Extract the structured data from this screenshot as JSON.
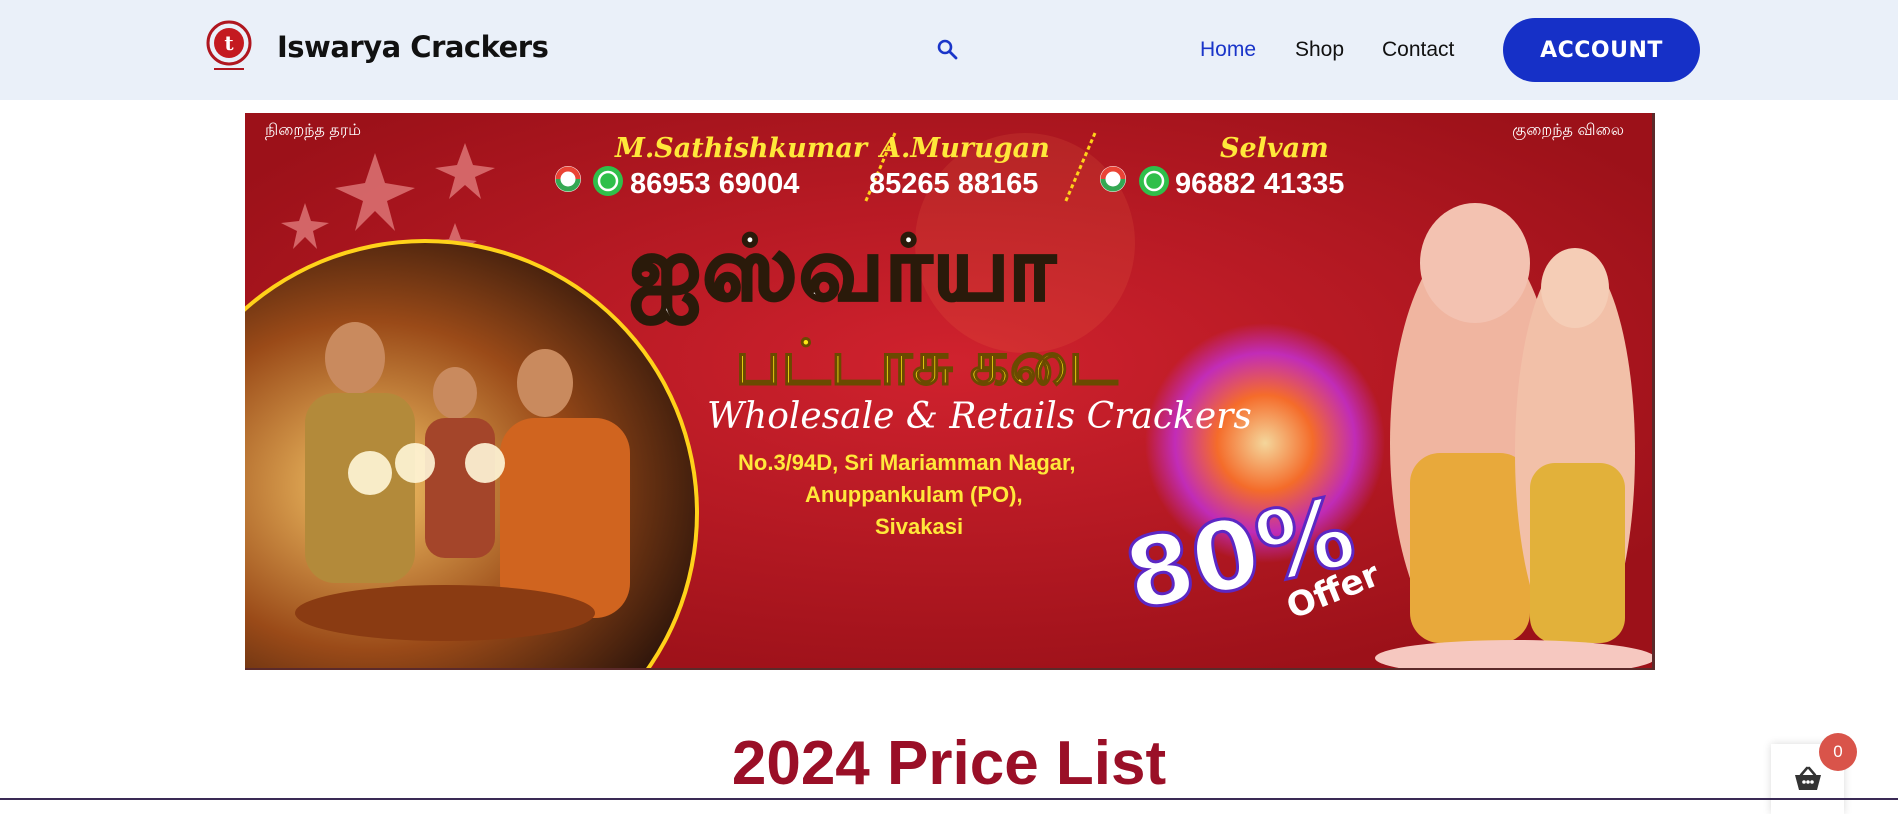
{
  "header": {
    "site_title": "Iswarya Crackers",
    "nav": [
      {
        "label": "Home",
        "active": true
      },
      {
        "label": "Shop",
        "active": false
      },
      {
        "label": "Contact",
        "active": false
      }
    ],
    "account_label": "ACCOUNT",
    "accent_color": "#1630c7",
    "icons": [
      "logo-icon",
      "search-icon"
    ]
  },
  "banner": {
    "corner_left": "நிறைந்த தரம்",
    "corner_right": "குறைந்த விலை",
    "contacts": [
      {
        "name": "M.Sathishkumar",
        "phone": "86953 69004",
        "icons": [
          "gpay-icon",
          "whatsapp-icon"
        ]
      },
      {
        "name": "A.Murugan",
        "phone": "85265 88165",
        "icons": []
      },
      {
        "name": "Selvam",
        "phone": "96882 41335",
        "icons": [
          "gpay-icon",
          "whatsapp-icon"
        ]
      }
    ],
    "shop_name_tamil": "ஐஸ்வர்யா",
    "shop_type_tamil": "பட்டாசு கடை",
    "tagline": "Wholesale & Retails Crackers",
    "address": [
      "No.3/94D,  Sri Mariamman Nagar,",
      "Anuppankulam (PO),",
      "Sivakasi"
    ],
    "offer_percent": "80%",
    "offer_word": "Offer",
    "background_color": "#b81725"
  },
  "main": {
    "heading": "2024 Price List"
  },
  "cart": {
    "count": "0",
    "icon": "basket-icon"
  }
}
